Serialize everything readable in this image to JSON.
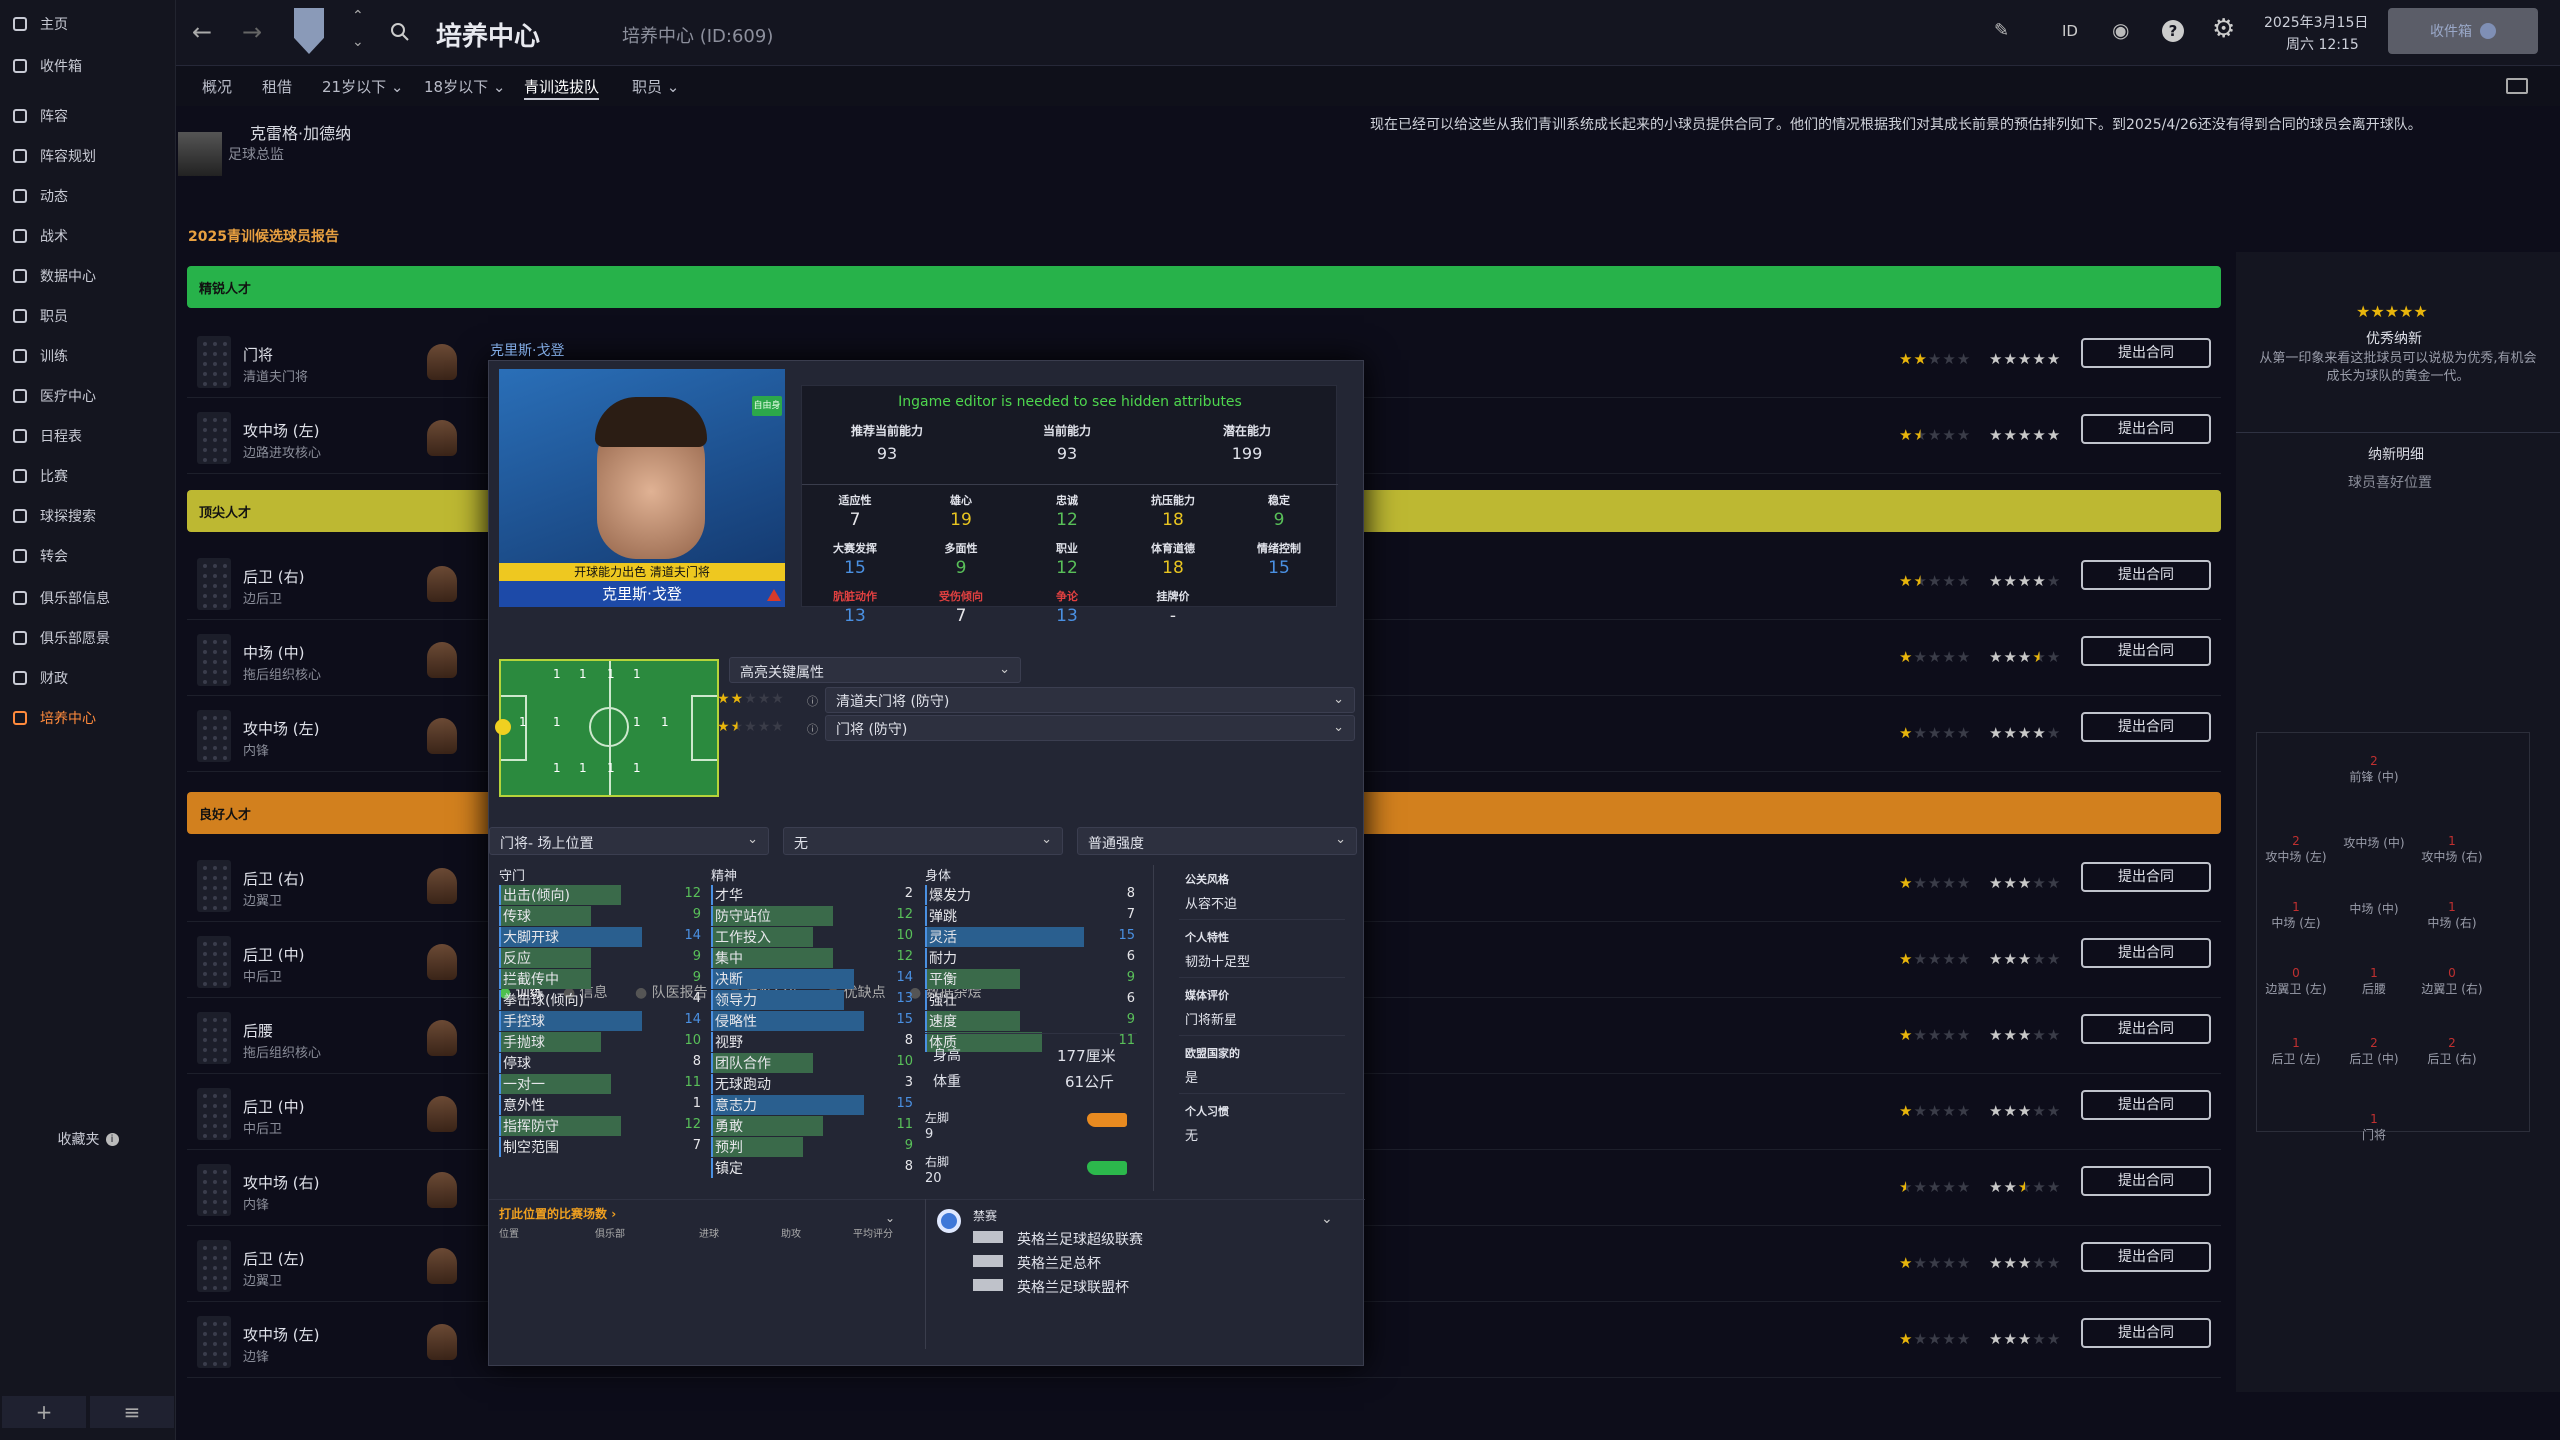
{
  "sidebar": {
    "items": [
      {
        "label": "主页",
        "icon": "home-icon"
      },
      {
        "label": "收件箱",
        "icon": "inbox-icon"
      },
      {
        "label": "阵容",
        "icon": "shirt-icon"
      },
      {
        "label": "阵容规划",
        "icon": "clipboard-icon"
      },
      {
        "label": "动态",
        "icon": "dynamics-icon"
      },
      {
        "label": "战术",
        "icon": "tactics-icon"
      },
      {
        "label": "数据中心",
        "icon": "data-icon"
      },
      {
        "label": "职员",
        "icon": "staff-icon"
      },
      {
        "label": "训练",
        "icon": "training-icon"
      },
      {
        "label": "医疗中心",
        "icon": "medical-icon"
      },
      {
        "label": "日程表",
        "icon": "calendar-icon"
      },
      {
        "label": "比赛",
        "icon": "trophy-icon"
      },
      {
        "label": "球探搜索",
        "icon": "search-icon"
      },
      {
        "label": "转会",
        "icon": "transfer-icon"
      },
      {
        "label": "俱乐部信息",
        "icon": "shield-icon"
      },
      {
        "label": "俱乐部愿景",
        "icon": "vision-icon"
      },
      {
        "label": "财政",
        "icon": "finance-icon"
      },
      {
        "label": "培养中心",
        "icon": "development-icon"
      }
    ],
    "favorites": "收藏夹",
    "bottom_add": "+",
    "bottom_menu": "≡"
  },
  "topbar": {
    "title": "培养中心",
    "subtitle": "培养中心 (ID:609)",
    "id_label": "ID",
    "date": "2025年3月15日",
    "time": "周六 12:15",
    "inbox_btn": "收件箱"
  },
  "subnav": [
    "概况",
    "租借",
    "21岁以下",
    "18岁以下",
    "青训选拔队",
    "职员"
  ],
  "director": {
    "name": "克雷格·加德纳",
    "role": "足球总监"
  },
  "message": "现在已经可以给这些从我们青训系统成长起来的小球员提供合同了。他们的情况根据我们对其成长前景的预估排列如下。到2025/4/26还没有得到合同的球员会离开球队。",
  "report_title": "2025青训候选球员报告",
  "bands": {
    "elite": "精锐人才",
    "top": "顶尖人才",
    "good": "良好人才"
  },
  "offer_label": "提出合同",
  "players": [
    {
      "name": "门将",
      "role": "清道夫门将",
      "ca": 2,
      "pa": 5,
      "pa_color": "w"
    },
    {
      "name": "攻中场 (左)",
      "role": "边路进攻核心",
      "ca": 1.5,
      "pa": 5,
      "pa_color": "w"
    },
    {
      "name": "后卫 (右)",
      "role": "边后卫",
      "ca": 1.5,
      "pa": 4,
      "pa_color": "w"
    },
    {
      "name": "中场 (中)",
      "role": "拖后组织核心",
      "ca": 1,
      "pa": 3.5,
      "pa_color": "w"
    },
    {
      "name": "攻中场 (左)",
      "role": "内锋",
      "ca": 1,
      "pa": 4,
      "pa_color": "w"
    },
    {
      "name": "后卫 (右)",
      "role": "边翼卫",
      "ca": 1,
      "pa": 3,
      "pa_color": "w"
    },
    {
      "name": "后卫 (中)",
      "role": "中后卫",
      "ca": 1,
      "pa": 3,
      "pa_color": "w"
    },
    {
      "name": "后腰",
      "role": "拖后组织核心",
      "ca": 1,
      "pa": 3,
      "pa_color": "w"
    },
    {
      "name": "后卫 (中)",
      "role": "中后卫",
      "ca": 1,
      "pa": 3,
      "pa_color": "w"
    },
    {
      "name": "攻中场 (右)",
      "role": "内锋",
      "ca": 0.5,
      "pa": 2.5,
      "pa_color": "w"
    },
    {
      "name": "后卫 (左)",
      "role": "边翼卫",
      "ca": 1,
      "pa": 3,
      "pa_color": "w"
    },
    {
      "name": "攻中场 (左)",
      "role": "边锋",
      "ca": 1,
      "pa": 3,
      "pa_color": "w"
    }
  ],
  "hover_name": "克里斯·戈登",
  "right_panel": {
    "stars": "★★★★★",
    "title": "优秀纳新",
    "desc": "从第一印象来看这批球员可以说极为优秀,有机会成长为球队的黄金一代。",
    "star_label": "纳新明细",
    "pos_label": "球员喜好位置",
    "pitch": [
      {
        "n": "2",
        "l": "前锋 (中)"
      },
      {
        "n": "2",
        "l": "攻中场 (左)"
      },
      {
        "n": "",
        "l": "攻中场 (中)"
      },
      {
        "n": "1",
        "l": "攻中场 (右)"
      },
      {
        "n": "1",
        "l": "中场 (左)"
      },
      {
        "n": "",
        "l": "中场 (中)"
      },
      {
        "n": "1",
        "l": "中场 (右)"
      },
      {
        "n": "0",
        "l": "边翼卫 (左)"
      },
      {
        "n": "1",
        "l": "后腰"
      },
      {
        "n": "0",
        "l": "边翼卫 (右)"
      },
      {
        "n": "1",
        "l": "后卫 (左)"
      },
      {
        "n": "2",
        "l": "后卫 (中)"
      },
      {
        "n": "2",
        "l": "后卫 (右)"
      },
      {
        "n": "1",
        "l": "门将"
      }
    ]
  },
  "popup": {
    "tag": "自由身",
    "caption": "开球能力出色 清道夫门将",
    "name": "克里斯·戈登",
    "editor_note": "Ingame editor is needed to see hidden attributes",
    "abilities": [
      {
        "k": "推荐当前能力",
        "v": "93"
      },
      {
        "k": "当前能力",
        "v": "93"
      },
      {
        "k": "潜在能力",
        "v": "199"
      }
    ],
    "hidden": [
      {
        "k": "适应性",
        "v": "7",
        "c": "ca"
      },
      {
        "k": "雄心",
        "v": "19",
        "c": "cy"
      },
      {
        "k": "忠诚",
        "v": "12",
        "c": "cg"
      },
      {
        "k": "抗压能力",
        "v": "18",
        "c": "cy"
      },
      {
        "k": "稳定",
        "v": "9",
        "c": "cg"
      },
      {
        "k": "大赛发挥",
        "v": "15",
        "c": "cb"
      },
      {
        "k": "多面性",
        "v": "9",
        "c": "cg"
      },
      {
        "k": "职业",
        "v": "12",
        "c": "cg"
      },
      {
        "k": "体育道德",
        "v": "18",
        "c": "cy"
      },
      {
        "k": "情绪控制",
        "v": "15",
        "c": "cb"
      },
      {
        "k": "肮脏动作",
        "v": "13",
        "c": "cb",
        "r": 1
      },
      {
        "k": "受伤倾向",
        "v": "7",
        "c": "ca",
        "r": 1
      },
      {
        "k": "争论",
        "v": "13",
        "c": "cb",
        "r": 1
      },
      {
        "k": "挂牌价",
        "v": "-",
        "c": "ca"
      }
    ],
    "tabs": [
      "训练",
      "信息",
      "队医报告",
      "属性分析",
      "优缺点",
      "数据杂烩"
    ],
    "highlight": "高亮关键属性",
    "roles": [
      {
        "label": "清道夫门将 (防守)",
        "stars": 2
      },
      {
        "label": "门将 (防守)",
        "stars": 1.5
      }
    ],
    "pos_dd": "门将- 场上位置",
    "dd2": "无",
    "dd3": "普通强度",
    "heads": {
      "gk": "守门",
      "mental": "精神",
      "physical": "身体"
    },
    "gk": [
      {
        "k": "出击(倾向)",
        "v": 12
      },
      {
        "k": "传球",
        "v": 9
      },
      {
        "k": "大脚开球",
        "v": 14
      },
      {
        "k": "反应",
        "v": 9
      },
      {
        "k": "拦截传中",
        "v": 9
      },
      {
        "k": "拳击球(倾向)",
        "v": 4
      },
      {
        "k": "手控球",
        "v": 14
      },
      {
        "k": "手抛球",
        "v": 10
      },
      {
        "k": "停球",
        "v": 8
      },
      {
        "k": "一对一",
        "v": 11
      },
      {
        "k": "意外性",
        "v": 1
      },
      {
        "k": "指挥防守",
        "v": 12
      },
      {
        "k": "制空范围",
        "v": 7
      }
    ],
    "mental": [
      {
        "k": "才华",
        "v": 2
      },
      {
        "k": "防守站位",
        "v": 12
      },
      {
        "k": "工作投入",
        "v": 10
      },
      {
        "k": "集中",
        "v": 12
      },
      {
        "k": "决断",
        "v": 14
      },
      {
        "k": "领导力",
        "v": 13
      },
      {
        "k": "侵略性",
        "v": 15
      },
      {
        "k": "视野",
        "v": 8
      },
      {
        "k": "团队合作",
        "v": 10
      },
      {
        "k": "无球跑动",
        "v": 3
      },
      {
        "k": "意志力",
        "v": 15
      },
      {
        "k": "勇敢",
        "v": 11
      },
      {
        "k": "预判",
        "v": 9
      },
      {
        "k": "镇定",
        "v": 8
      }
    ],
    "physical": [
      {
        "k": "爆发力",
        "v": 8
      },
      {
        "k": "弹跳",
        "v": 7
      },
      {
        "k": "灵活",
        "v": 15
      },
      {
        "k": "耐力",
        "v": 6
      },
      {
        "k": "平衡",
        "v": 9
      },
      {
        "k": "强壮",
        "v": 6
      },
      {
        "k": "速度",
        "v": 9
      },
      {
        "k": "体质",
        "v": 11
      }
    ],
    "height_k": "身高",
    "height_v": "177厘米",
    "weight_k": "体重",
    "weight_v": "61公斤",
    "left_foot": "左脚",
    "left_v": "9",
    "right_foot": "右脚",
    "right_v": "20",
    "traits": [
      {
        "k": "公关风格",
        "v": "从容不迫"
      },
      {
        "k": "个人特性",
        "v": "韧劲十足型"
      },
      {
        "k": "媒体评价",
        "v": "门将新星"
      },
      {
        "k": "欧盟国家的",
        "v": "是"
      },
      {
        "k": "个人习惯",
        "v": "无"
      }
    ],
    "stats_title": "打此位置的比赛场数",
    "stats_cols": [
      "位置",
      "俱乐部",
      "进球",
      "助攻",
      "平均评分"
    ],
    "comps_title": "禁赛",
    "comps": [
      "英格兰足球超级联赛",
      "英格兰足总杯",
      "英格兰足球联盟杯"
    ]
  },
  "colors": {
    "elite": "#27b24a",
    "top": "#bdb832",
    "good": "#d2801e",
    "accent": "#ff8a3c"
  }
}
